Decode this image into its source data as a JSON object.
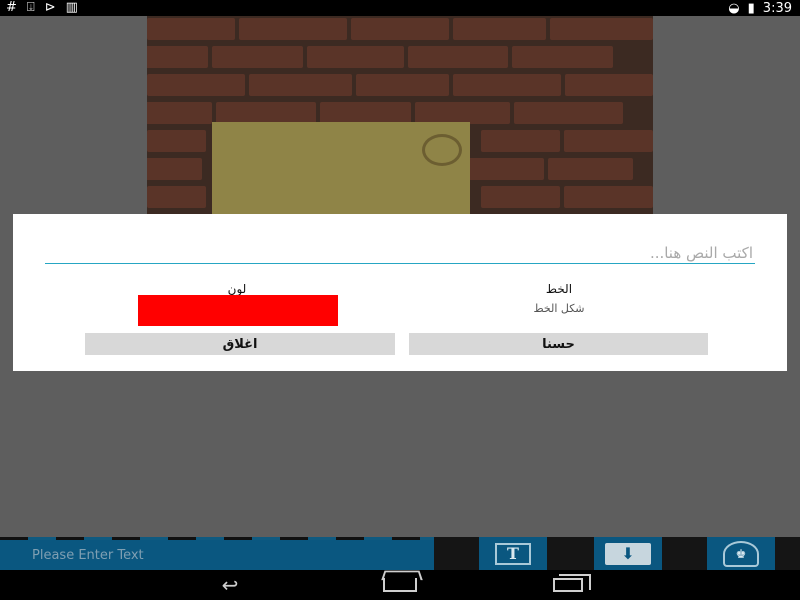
{
  "status_bar": {
    "icons_left": [
      "hash-icon",
      "download-icon",
      "play-store-icon",
      "barcode-icon"
    ],
    "hash_glyph": "#",
    "download_glyph": "⍗",
    "play_glyph": "⊳",
    "barcode_glyph": "▥",
    "wifi_glyph": "◒",
    "battery_glyph": "▮",
    "time": "3:39"
  },
  "dialog": {
    "input_placeholder": "اكتب النص هنا...",
    "input_value": "",
    "color_label": "لون",
    "selected_color": "#ff0000",
    "font_label": "الخط",
    "font_value": "شكل الخط",
    "close_button": "اغلاق",
    "ok_button": "حسنا"
  },
  "toolbar": {
    "input_placeholder": "Please Enter Text",
    "text_icon_glyph": "T",
    "save_icon_glyph": "⬇",
    "share_icon_glyph": "♚",
    "accent_color": "#0a5780"
  },
  "navbar": {
    "back_glyph": "↩",
    "home_glyph": "",
    "recent_glyph": ""
  }
}
